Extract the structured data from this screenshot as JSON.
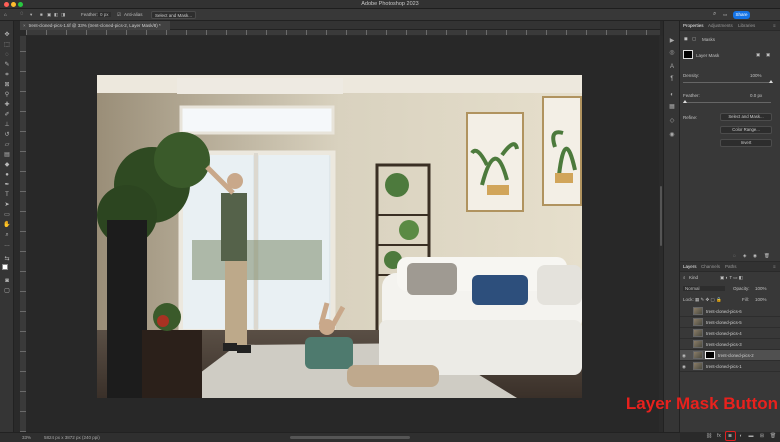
{
  "window": {
    "title": "Adobe Photoshop 2023"
  },
  "options_bar": {
    "feather_label": "Feather:",
    "feather_value": "0 px",
    "anti_alias_label": "Anti-alias",
    "select_mask_label": "Select and Mask...",
    "share_label": "Share"
  },
  "document": {
    "tab_label": "trent-cloned-pics-1.tif @ 33% (trent-cloned-pics-2, Layer Mask/8) *"
  },
  "status": {
    "zoom": "33%",
    "dimensions": "5824 px x 3872 px (240 ppi)"
  },
  "properties_panel": {
    "tabs": [
      "Properties",
      "Adjustments",
      "Libraries"
    ],
    "masks_label": "Masks",
    "layer_mask_label": "Layer Mask",
    "density_label": "Density:",
    "density_value": "100%",
    "density_level": 1.0,
    "feather_label": "Feather:",
    "feather_value": "0.0 px",
    "feather_level": 0.0,
    "refine_label": "Refine:",
    "buttons": [
      "Select and Mask...",
      "Color Range...",
      "Invert"
    ]
  },
  "layers_panel": {
    "tabs": [
      "Layers",
      "Channels",
      "Paths"
    ],
    "kind_label": "Kind",
    "blend_mode": "Normal",
    "opacity_label": "Opacity:",
    "opacity_value": "100%",
    "lock_label": "Lock:",
    "fill_label": "Fill:",
    "fill_value": "100%",
    "layers": [
      {
        "name": "trent-cloned-pics-6",
        "visible": false,
        "selected": false,
        "has_mask": false
      },
      {
        "name": "trent-cloned-pics-5",
        "visible": false,
        "selected": false,
        "has_mask": false
      },
      {
        "name": "trent-cloned-pics-4",
        "visible": false,
        "selected": false,
        "has_mask": false
      },
      {
        "name": "trent-cloned-pics-3",
        "visible": false,
        "selected": false,
        "has_mask": false
      },
      {
        "name": "trent-cloned-pics-2",
        "visible": true,
        "selected": true,
        "has_mask": true
      },
      {
        "name": "trent-cloned-pics-1",
        "visible": true,
        "selected": false,
        "has_mask": false
      }
    ]
  },
  "annotation": {
    "text": "Layer Mask Button",
    "color": "#e8211d"
  },
  "colors": {
    "accent": "#1473e6",
    "highlight": "#e02020"
  }
}
